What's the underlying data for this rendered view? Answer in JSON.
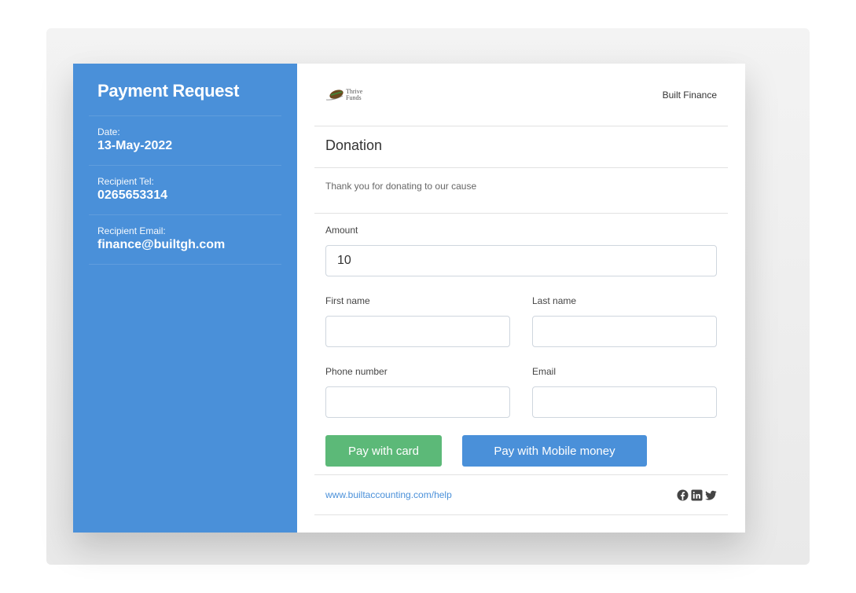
{
  "sidebar": {
    "title": "Payment Request",
    "items": [
      {
        "label": "Date:",
        "value": "13-May-2022"
      },
      {
        "label": "Recipient Tel:",
        "value": "0265653314"
      },
      {
        "label": "Recipient Email:",
        "value": "finance@builtgh.com"
      }
    ]
  },
  "header": {
    "logo_line1": "Thrive",
    "logo_line2": "Funds",
    "brand": "Built Finance"
  },
  "form": {
    "title": "Donation",
    "description": "Thank you for donating to our cause",
    "amount_label": "Amount",
    "amount_value": "10",
    "first_name_label": "First name",
    "last_name_label": "Last name",
    "phone_label": "Phone number",
    "email_label": "Email",
    "pay_card_label": "Pay with card",
    "pay_mobile_label": "Pay with Mobile money"
  },
  "footer": {
    "help_link": "www.builtaccounting.com/help",
    "social_icons": [
      "facebook-icon",
      "linkedin-icon",
      "twitter-icon"
    ]
  },
  "colors": {
    "sidebar": "#4a90d9",
    "pay_card": "#5cb978",
    "pay_mobile": "#4a90d9"
  }
}
